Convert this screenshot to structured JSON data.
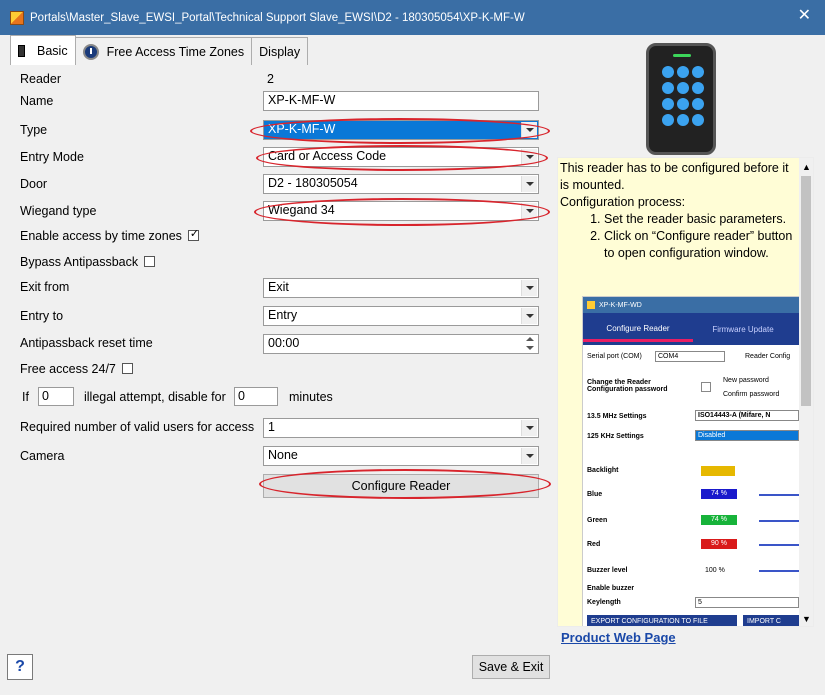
{
  "window": {
    "title": "Portals\\Master_Slave_EWSI_Portal\\Technical Support Slave_EWSI\\D2 - 180305054\\XP-K-MF-W",
    "close_glyph": "✕"
  },
  "tabs": [
    {
      "label": "Basic",
      "icon": "phone-icon",
      "active": true
    },
    {
      "label": "Free Access Time Zones",
      "icon": "clock-icon",
      "active": false
    },
    {
      "label": "Display",
      "active": false
    }
  ],
  "form": {
    "reader_label": "Reader",
    "reader_value": "2",
    "name_label": "Name",
    "name_value": "XP-K-MF-W",
    "type_label": "Type",
    "type_value": "XP-K-MF-W",
    "entry_mode_label": "Entry Mode",
    "entry_mode_value": "Card or Access Code",
    "door_label": "Door",
    "door_value": "D2 - 180305054",
    "wiegand_label": "Wiegand type",
    "wiegand_value": "Wiegand 34",
    "enable_tz_label": "Enable access by time zones",
    "bypass_label": "Bypass Antipassback",
    "exit_from_label": "Exit from",
    "exit_from_value": "Exit",
    "entry_to_label": "Entry to",
    "entry_to_value": "Entry",
    "apb_reset_label": "Antipassback reset time",
    "apb_reset_value": "00:00",
    "free_access_label": "Free access 24/7",
    "if_label": "If",
    "if_value": "0",
    "illegal_label": "illegal attempt, disable for",
    "disable_value": "0",
    "minutes_label": "minutes",
    "required_users_label": "Required number of valid users for access",
    "required_users_value": "1",
    "camera_label": "Camera",
    "camera_value": "None",
    "configure_button": "Configure Reader"
  },
  "info": {
    "intro": "This reader has to be configured before it is mounted.",
    "process_title": "Configuration process:",
    "steps": [
      "Set the reader basic parameters.",
      "Click on “Configure reader” button to open configuration window."
    ]
  },
  "inner_window": {
    "title": "XP-K-MF-WD",
    "tab_configure": "Configure Reader",
    "tab_firmware": "Firmware Update",
    "serial_label": "Serial port (COM)",
    "serial_value": "COM4",
    "reader_config_label": "Reader Config",
    "change_pw_label": "Change the Reader Configuration password",
    "new_pw_label": "New password",
    "confirm_pw_label": "Confirm password",
    "mhz_label": "13.5 MHz Settings",
    "mhz_value": "ISO14443-A (Mifare, N",
    "khz_label": "125 KHz Settings",
    "khz_value": "Disabled",
    "backlight_label": "Backlight",
    "blue_label": "Blue",
    "blue_value": "74 %",
    "green_label": "Green",
    "green_value": "74 %",
    "red_label": "Red",
    "red_value": "90 %",
    "buzzer_level_label": "Buzzer level",
    "buzzer_level_value": "100 %",
    "enable_buzzer_label": "Enable buzzer",
    "keylength_label": "Keylength",
    "keylength_value": "5",
    "export_button": "EXPORT CONFIGURATION TO FILE",
    "import_button": "IMPORT C"
  },
  "links": {
    "product_page": "Product Web Page"
  },
  "footer": {
    "help": "?",
    "save_exit": "Save & Exit"
  }
}
